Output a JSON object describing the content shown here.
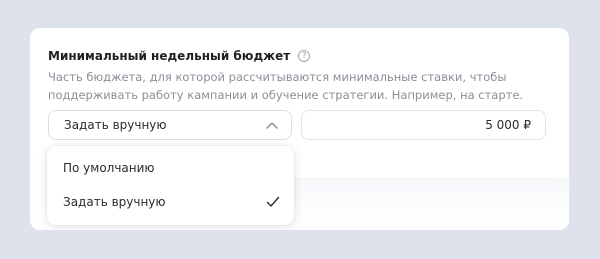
{
  "section": {
    "title": "Минимальный недельный бюджет",
    "help_glyph": "?",
    "description": "Часть бюджета, для которой рассчитываются минимальные ставки, чтобы поддерживать работу кампании и обучение стратегии. Например, на старте."
  },
  "select": {
    "value": "Задать вручную",
    "expanded": true,
    "icon": "chevron-up-icon"
  },
  "amount": {
    "value": "5 000 ₽"
  },
  "dropdown": {
    "options": [
      {
        "label": "По умолчанию",
        "selected": false
      },
      {
        "label": "Задать вручную",
        "selected": true
      }
    ],
    "selected_icon": "checkmark-icon"
  },
  "colors": {
    "background": "#dde2ec",
    "card": "#ffffff",
    "text_primary": "#1f2022",
    "text_secondary": "#8a8f98"
  }
}
